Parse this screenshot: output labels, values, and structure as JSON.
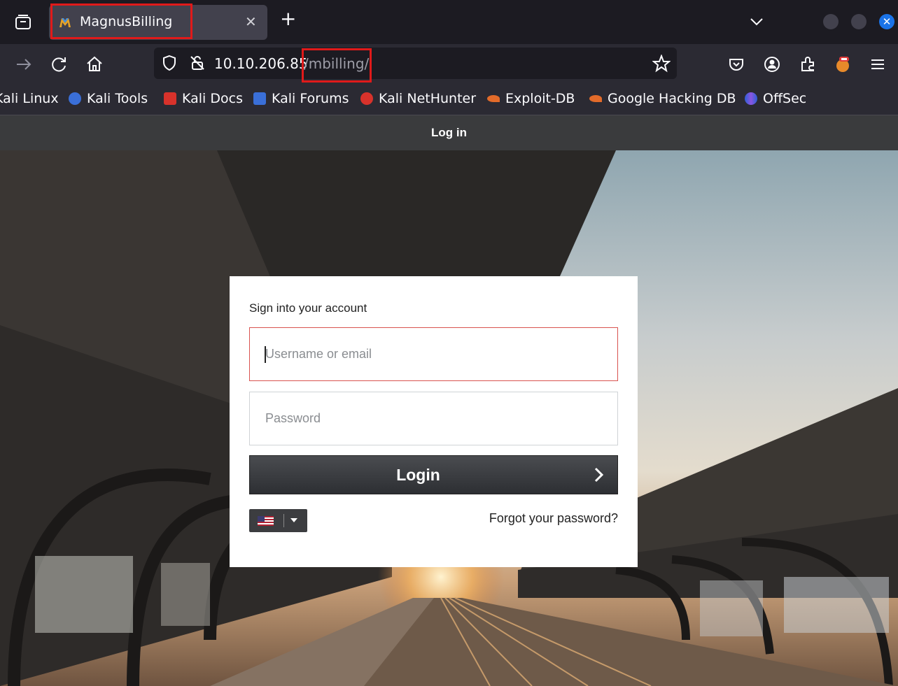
{
  "browser": {
    "tab": {
      "title": "MagnusBilling",
      "close_label": "✕"
    },
    "new_tab_label": "+",
    "address": {
      "host": "10.10.206.85",
      "path": "/mbilling/"
    },
    "bookmarks": [
      {
        "label": "Kali Linux",
        "color": "#3d7bd9"
      },
      {
        "label": "Kali Tools",
        "color": "#3a6fd8"
      },
      {
        "label": "Kali Docs",
        "color": "#d8322b"
      },
      {
        "label": "Kali Forums",
        "color": "#3a6fd8"
      },
      {
        "label": "Kali NetHunter",
        "color": "#d8322b"
      },
      {
        "label": "Exploit-DB",
        "color": "#e36b2a"
      },
      {
        "label": "Google Hacking DB",
        "color": "#e36b2a"
      },
      {
        "label": "OffSec",
        "color": "#4a6be0"
      }
    ]
  },
  "page": {
    "header_title": "Log in",
    "card": {
      "title": "Sign into your account",
      "username_placeholder": "Username or email",
      "password_placeholder": "Password",
      "login_label": "Login",
      "forgot_label": "Forgot your password?",
      "language": "en-US"
    }
  }
}
